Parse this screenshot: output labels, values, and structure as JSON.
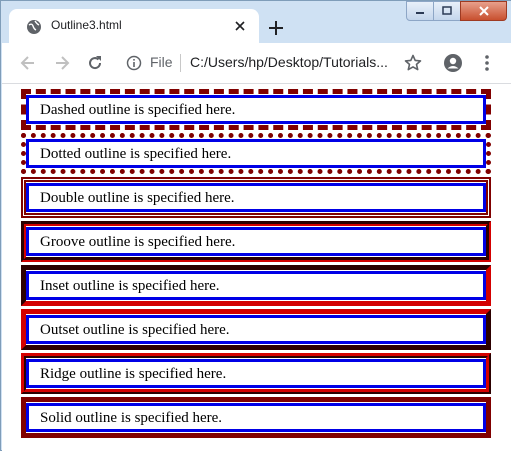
{
  "browser": {
    "tab_title": "Outline3.html",
    "scheme_label": "File",
    "url": "C:/Users/hp/Desktop/Tutorials..."
  },
  "page": {
    "boxes": [
      {
        "label": "Dashed outline is specified here.",
        "style": "dashed"
      },
      {
        "label": "Dotted outline is specified here.",
        "style": "dotted"
      },
      {
        "label": "Double outline is specified here.",
        "style": "double"
      },
      {
        "label": "Groove outline is specified here.",
        "style": "groove"
      },
      {
        "label": "Inset outline is specified here.",
        "style": "inset"
      },
      {
        "label": "Outset outline is specified here.",
        "style": "outset"
      },
      {
        "label": "Ridge outline is specified here.",
        "style": "ridge"
      },
      {
        "label": "Solid outline is specified here.",
        "style": "solid"
      }
    ],
    "outline_color": "#800000",
    "border_color": "#0000e6"
  }
}
